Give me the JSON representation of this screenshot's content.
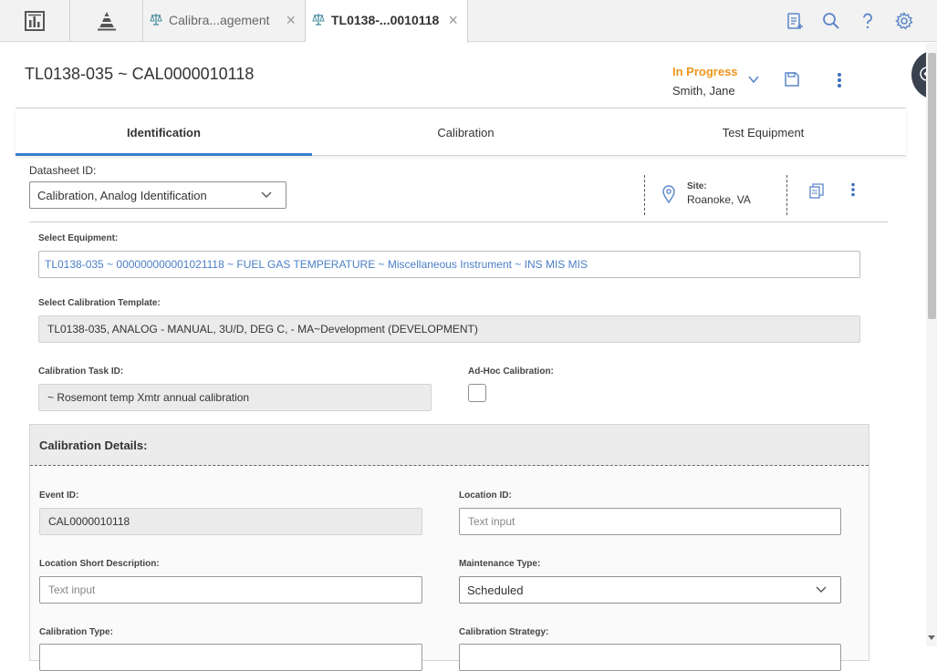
{
  "topbar": {
    "tabs": [
      {
        "label": "Calibra...agement"
      },
      {
        "label": "TL0138-...0010118"
      }
    ]
  },
  "header": {
    "title": "TL0138-035 ~ CAL0000010118",
    "status": "In Progress",
    "owner": "Smith, Jane"
  },
  "section_tabs": [
    {
      "label": "Identification"
    },
    {
      "label": "Calibration"
    },
    {
      "label": "Test Equipment"
    }
  ],
  "datasheet": {
    "label": "Datasheet ID:",
    "value": "Calibration, Analog Identification"
  },
  "site": {
    "label": "Site:",
    "value": "Roanoke, VA"
  },
  "form": {
    "select_equipment": {
      "label": "Select Equipment:",
      "value": "TL0138-035 ~ 000000000001021118 ~ FUEL GAS TEMPERATURE ~ Miscellaneous Instrument ~ INS MIS MIS"
    },
    "select_template": {
      "label": "Select Calibration Template:",
      "value": "TL0138-035, ANALOG - MANUAL, 3U/D, DEG C,  - MA~Development (DEVELOPMENT)"
    },
    "task_id": {
      "label": "Calibration Task ID:",
      "value": "~ Rosemont temp  Xmtr annual calibration"
    },
    "adhoc": {
      "label": "Ad-Hoc Calibration:",
      "checked": false
    }
  },
  "details": {
    "title": "Calibration Details:",
    "event_id": {
      "label": "Event ID:",
      "value": "CAL0000010118"
    },
    "location_id": {
      "label": "Location ID:",
      "placeholder": "Text input"
    },
    "location_short": {
      "label": "Location Short Description:",
      "placeholder": "Text input"
    },
    "maintenance_type": {
      "label": "Maintenance Type:",
      "value": "Scheduled"
    },
    "calibration_type": {
      "label": "Calibration Type:"
    },
    "calibration_strategy": {
      "label": "Calibration Strategy:"
    }
  },
  "colors": {
    "accent": "#3a7fcf",
    "status": "#f0951c",
    "link": "#4a7fc6",
    "icon": "#5b86c9"
  }
}
